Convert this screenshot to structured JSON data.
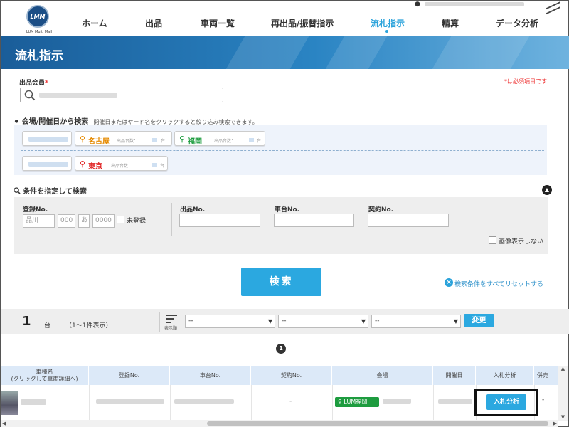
{
  "header": {
    "logo_text": "LMM",
    "logo_sub": "LUM Multi Mall",
    "nav": [
      {
        "label": "ホーム"
      },
      {
        "label": "出品"
      },
      {
        "label": "車両一覧"
      },
      {
        "label": "再出品/振替指示"
      },
      {
        "label": "流札指示",
        "active": true
      },
      {
        "label": "精算"
      },
      {
        "label": "データ分析"
      }
    ],
    "accent_color": "#2ba3db"
  },
  "banner": {
    "title": "流札指示"
  },
  "form": {
    "member_label": "出品会員",
    "required_mark": "*",
    "required_note": "*は必須項目です",
    "venue_section_title": "会場/開催日から検索",
    "venue_section_note": "開催日またはヤード名をクリックすると絞り込み検索できます。",
    "venues": [
      {
        "name": "名古屋",
        "color": "#e58a00",
        "count_label": "出品台数：",
        "unit": "台"
      },
      {
        "name": "福岡",
        "color": "#1e9c3f",
        "count_label": "出品台数：",
        "unit": "台"
      },
      {
        "name": "東京",
        "color": "#e02020",
        "count_label": "出品台数：",
        "unit": "台"
      }
    ],
    "condition_section_title": "条件を指定して検索",
    "reg_no_label": "登録No.",
    "reg_area_placeholder": "品川",
    "reg_class_placeholder": "000",
    "reg_kana_placeholder": "あ",
    "reg_number_placeholder": "0000",
    "unregistered_label": "未登録",
    "listing_no_label": "出品No.",
    "chassis_no_label": "車台No.",
    "contract_no_label": "契約No.",
    "hide_images_label": "画像表示しない",
    "search_button": "検索",
    "reset_link": "検索条件をすべてリセットする"
  },
  "results": {
    "count": "1",
    "unit": "台",
    "range_text": "（1〜1件表示）",
    "sort_label": "表示順",
    "selects": [
      "--",
      "--",
      "--"
    ],
    "change_button": "変更",
    "page_current": "1",
    "columns": [
      "車種名\n(クリックして車両詳細へ)",
      "登録No.",
      "車台No.",
      "契約No.",
      "会場",
      "開催日",
      "入札分析",
      "併売"
    ],
    "row": {
      "contract_no": "-",
      "venue_badge": "LUM福岡",
      "analysis_button": "入札分析",
      "concurrent": "-"
    }
  }
}
